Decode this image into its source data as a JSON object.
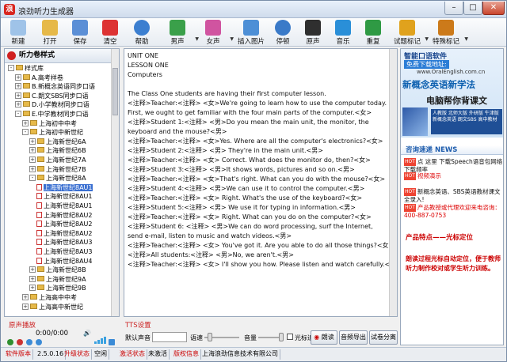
{
  "window": {
    "title": "浪劲听力生成器",
    "min": "–",
    "max": "□",
    "close": "✕"
  },
  "toolbar": [
    {
      "label": "新建",
      "icon": "new-doc-icon"
    },
    {
      "label": "打开",
      "icon": "folder-icon"
    },
    {
      "label": "保存",
      "icon": "save-icon"
    },
    {
      "label": "清空",
      "icon": "clear-icon"
    },
    {
      "label": "帮助",
      "icon": "help-icon"
    },
    {
      "label": "男声",
      "icon": "male-voice-icon"
    },
    {
      "label": "女声",
      "icon": "female-voice-icon"
    },
    {
      "label": "插入图片",
      "icon": "insert-image-icon"
    },
    {
      "label": "停顿",
      "icon": "pause-clock-icon"
    },
    {
      "label": "原声",
      "icon": "original-audio-icon"
    },
    {
      "label": "音乐",
      "icon": "music-icon"
    },
    {
      "label": "重复",
      "icon": "repeat-icon"
    },
    {
      "label": "试题标记",
      "icon": "question-mark-icon"
    },
    {
      "label": "特殊标记",
      "icon": "special-mark-icon"
    }
  ],
  "library": {
    "title": "听力卷样式",
    "tree": [
      {
        "label": "样式库",
        "depth": 0,
        "kind": "folder",
        "exp": "-"
      },
      {
        "label": "A.高考样卷",
        "depth": 1,
        "kind": "folder",
        "exp": "+"
      },
      {
        "label": "B.新概念英语同步口语",
        "depth": 1,
        "kind": "folder",
        "exp": "+"
      },
      {
        "label": "C.朗文SBS同步口语",
        "depth": 1,
        "kind": "folder",
        "exp": "+"
      },
      {
        "label": "D.小学教材同步口语",
        "depth": 1,
        "kind": "folder",
        "exp": "+"
      },
      {
        "label": "E.中学教材同步口语",
        "depth": 1,
        "kind": "folder",
        "exp": "-"
      },
      {
        "label": "上海初中中考",
        "depth": 2,
        "kind": "folder",
        "exp": "+"
      },
      {
        "label": "上海初中新世纪",
        "depth": 2,
        "kind": "folder",
        "exp": "-"
      },
      {
        "label": "上海新世纪6A",
        "depth": 3,
        "kind": "folder",
        "exp": "+"
      },
      {
        "label": "上海新世纪6B",
        "depth": 3,
        "kind": "folder",
        "exp": "+"
      },
      {
        "label": "上海新世纪7A",
        "depth": 3,
        "kind": "folder",
        "exp": "+"
      },
      {
        "label": "上海新世纪7B",
        "depth": 3,
        "kind": "folder",
        "exp": "+"
      },
      {
        "label": "上海新世纪8A",
        "depth": 3,
        "kind": "folder",
        "exp": "-"
      },
      {
        "label": "上海新世纪8AU1",
        "depth": 4,
        "kind": "doc",
        "selected": true
      },
      {
        "label": "上海新世纪8AU1",
        "depth": 4,
        "kind": "doc"
      },
      {
        "label": "上海新世纪8AU1",
        "depth": 4,
        "kind": "doc"
      },
      {
        "label": "上海新世纪8AU2",
        "depth": 4,
        "kind": "doc"
      },
      {
        "label": "上海新世纪8AU2",
        "depth": 4,
        "kind": "doc"
      },
      {
        "label": "上海新世纪8AU2",
        "depth": 4,
        "kind": "doc"
      },
      {
        "label": "上海新世纪8AU3",
        "depth": 4,
        "kind": "doc"
      },
      {
        "label": "上海新世纪8AU3",
        "depth": 4,
        "kind": "doc"
      },
      {
        "label": "上海新世纪8AU4",
        "depth": 4,
        "kind": "doc"
      },
      {
        "label": "上海新世纪8B",
        "depth": 3,
        "kind": "folder",
        "exp": "+"
      },
      {
        "label": "上海新世纪9A",
        "depth": 3,
        "kind": "folder",
        "exp": "+"
      },
      {
        "label": "上海新世纪9B",
        "depth": 3,
        "kind": "folder",
        "exp": "+"
      },
      {
        "label": "上海高中中考",
        "depth": 2,
        "kind": "folder",
        "exp": "+"
      },
      {
        "label": "上海高中新世纪",
        "depth": 2,
        "kind": "folder",
        "exp": "+"
      }
    ]
  },
  "player": {
    "title": "原声播放",
    "time": "0:00/0:00"
  },
  "editor": {
    "lines": [
      {
        "t": "UNIT ONE"
      },
      {
        "t": "LESSON ONE"
      },
      {
        "t": "Computers"
      },
      {
        "t": ""
      },
      {
        "t": "The Class One students are having their first computer lesson."
      },
      {
        "t": "<注释>Teacher:<注释> <女>We're going to learn how to use the computer today. First, we ought to get familiar with the four main parts of the computer.<女>",
        "wrap": true
      },
      {
        "t": "<注释>Student 1:<注释> <男>Do you mean the main unit, the monitor, the keyboard and the mouse?<男>",
        "wrap": true
      },
      {
        "t": "<注释>Teacher:<注释> <女>Yes. Where are all the computer's electronics?<女>"
      },
      {
        "t": "<注释>Student 2:<注释> <男> They're in the main unit.<男>"
      },
      {
        "t": "<注释>Teacher:<注释> <女> Correct. What does the monitor do, then?<女>"
      },
      {
        "t": "<注释>Student 3:<注释> <男>It shows words, pictures and so on.<男>"
      },
      {
        "t": "<注释>Teacher:<注释> <女>That's right. What can you do with the mouse?<女>"
      },
      {
        "t": "<注释>Student 4:<注释> <男>We can use it to control the computer.<男>"
      },
      {
        "t": "<注释>Teacher:<注释> <女> Right. What's the use of the keyboard?<女>"
      },
      {
        "t": "<注释>Student 5:<注释> <男> We use it for typing in information.<男>"
      },
      {
        "t": "<注释>Teacher:<注释> <女> Right. What can you do on the computer?<女>"
      },
      {
        "t": "<注释>Student 6: <注释> <男>We can do word processing, surf the Internet, send e-mail, listen to music and watch videos.<男>",
        "wrap": true
      },
      {
        "t": "<注释>Teacher:<注释> <女> You've got it. Are you able to do all those things?<女>"
      },
      {
        "t": "<注释>All students:<注释> <男>No, we aren't.<男>"
      },
      {
        "t": "<注释>Teacher:<注释> <女> I'll show you how. Please listen and watch carefully.<女>"
      }
    ]
  },
  "tts": {
    "title": "TTS设置",
    "voice_label": "默认声音",
    "speed_label": "语速",
    "volume_label": "音量",
    "cursor_follow": "光标追踪",
    "read_btn": "朗读",
    "export_btn": "音频导出",
    "split_btn": "试卷分离"
  },
  "ad": {
    "row1": "智能口语软件",
    "row2": "免费下载地址:",
    "row3": "www.OralEnglish.com.cn",
    "big1": "新概念英语新学法",
    "big2": "电脑帮你背课文",
    "box": "人教版  北师大版  外研版  牛津版  新概念英语  朗文SBS  高中教材"
  },
  "news": {
    "title": "咨询速递 NEWS",
    "items": [
      {
        "hot": "HOT",
        "text": "点 这里 下载Speech语音包网络下载频率"
      },
      {
        "hot": "HOT",
        "text": "视频演示"
      },
      {
        "hot": "HOT",
        "text": "新概念英语、SBS英语教材课文全录入!"
      },
      {
        "hot": "HOT",
        "text": "产品教授或代理欢迎来电咨询：400-887-0753"
      }
    ],
    "promo_title": "产品特点——光标定位",
    "promo_text": "朗读过程光标自动定位，便于教师听力制作校对或学生听力训练。"
  },
  "status": [
    {
      "text": "软件版本",
      "red": true
    },
    {
      "text": "2.5.0.16"
    },
    {
      "text": "升级状态",
      "red": true
    },
    {
      "text": "空闲"
    },
    {
      "text": "激活状态",
      "red": true
    },
    {
      "text": "未激活"
    },
    {
      "text": "版权信息",
      "red": true
    },
    {
      "text": "上海浪劲信息技术有限公司"
    }
  ]
}
